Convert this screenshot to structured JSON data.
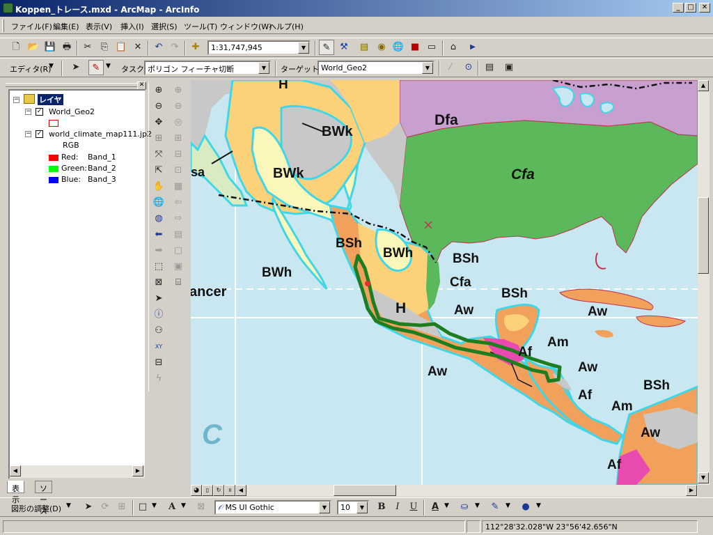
{
  "window": {
    "title": "Koppen_トレース.mxd - ArcMap - ArcInfo",
    "minimize": "_",
    "maximize": "□",
    "close": "✕"
  },
  "menu": [
    "ファイル(F)",
    "編集(E)",
    "表示(V)",
    "挿入(I)",
    "選択(S)",
    "ツール(T)",
    "ウィンドウ(W)",
    "ヘルプ(H)"
  ],
  "standard_toolbar": {
    "scale": "1:31,747,945"
  },
  "editor_toolbar": {
    "editor_label": "エディタ(R)",
    "task_label": "タスク:",
    "task_value": "ポリゴン フィーチャ切断",
    "target_label": "ターゲット:",
    "target_value": "World_Geo2"
  },
  "toc": {
    "root": "レイヤ",
    "layers": [
      {
        "name": "World_Geo2",
        "checked": true
      },
      {
        "name": "world_climate_map111.jp2",
        "checked": true
      }
    ],
    "rgb_label": "RGB",
    "bands": [
      {
        "color_name": "Red:",
        "band": "Band_1",
        "color": "#ff0000"
      },
      {
        "color_name": "Green:",
        "band": "Band_2",
        "color": "#00ff00"
      },
      {
        "color_name": "Blue:",
        "band": "Band_3",
        "color": "#0000ff"
      }
    ],
    "tabs": [
      "表示",
      "ソース"
    ]
  },
  "map": {
    "labels": [
      "H",
      "BWk",
      "Dfa",
      "Cfa",
      "sa",
      "BWk",
      "BSh",
      "BWh",
      "BWh",
      "BSh",
      "Cfa",
      "BSh",
      "Aw",
      "ancer",
      "H",
      "Aw",
      "Am",
      "Af",
      "Aw",
      "Aw",
      "Af",
      "BSh",
      "Am",
      "Aw",
      "Af",
      "C"
    ]
  },
  "draw_toolbar": {
    "drawing_label": "図形の調整(D)",
    "font_name": "MS UI Gothic",
    "font_size": "10",
    "bold": "B",
    "italic": "I",
    "underline": "U"
  },
  "status": {
    "coordinates": "112°28'32.028\"W  23°56'42.656\"N"
  },
  "colors": {
    "water": "#c8e7f0",
    "cfa_green": "#5bb85b",
    "dfa_purple": "#c7a0cf",
    "bwk_yellow": "#fbd27a",
    "bwh_light": "#fbf6b9",
    "highland_gray": "#c8c8c8",
    "aw_orange": "#f2a15c",
    "trace_green": "#1e7d1e",
    "outline_cyan": "#3fd6e8"
  }
}
